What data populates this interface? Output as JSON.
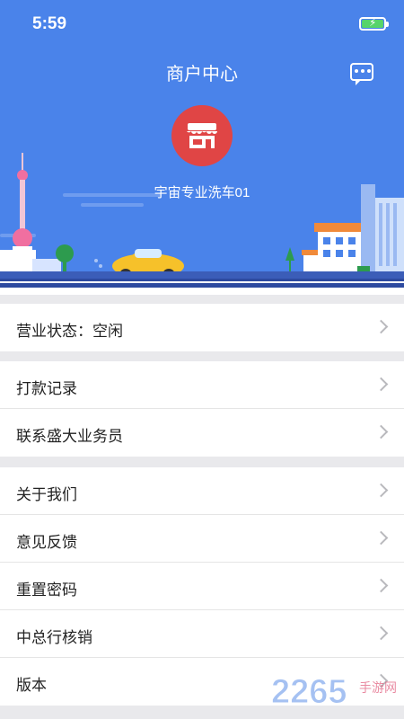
{
  "status_bar": {
    "time": "5:59"
  },
  "header": {
    "title": "商户中心"
  },
  "merchant": {
    "name": "宇宙专业洗车01"
  },
  "menu_groups": [
    {
      "items": [
        {
          "label": "营业状态：空闲"
        }
      ]
    },
    {
      "items": [
        {
          "label": "打款记录"
        },
        {
          "label": "联系盛大业务员"
        }
      ]
    },
    {
      "items": [
        {
          "label": "关于我们"
        },
        {
          "label": "意见反馈"
        },
        {
          "label": "重置密码"
        },
        {
          "label": "中总行核销"
        },
        {
          "label": "版本"
        }
      ]
    }
  ],
  "colors": {
    "header_bg": "#4a83ea",
    "avatar_bg": "#e04545",
    "page_bg": "#e9e9ec"
  },
  "watermark": {
    "number": "2265",
    "text": "手游网"
  }
}
